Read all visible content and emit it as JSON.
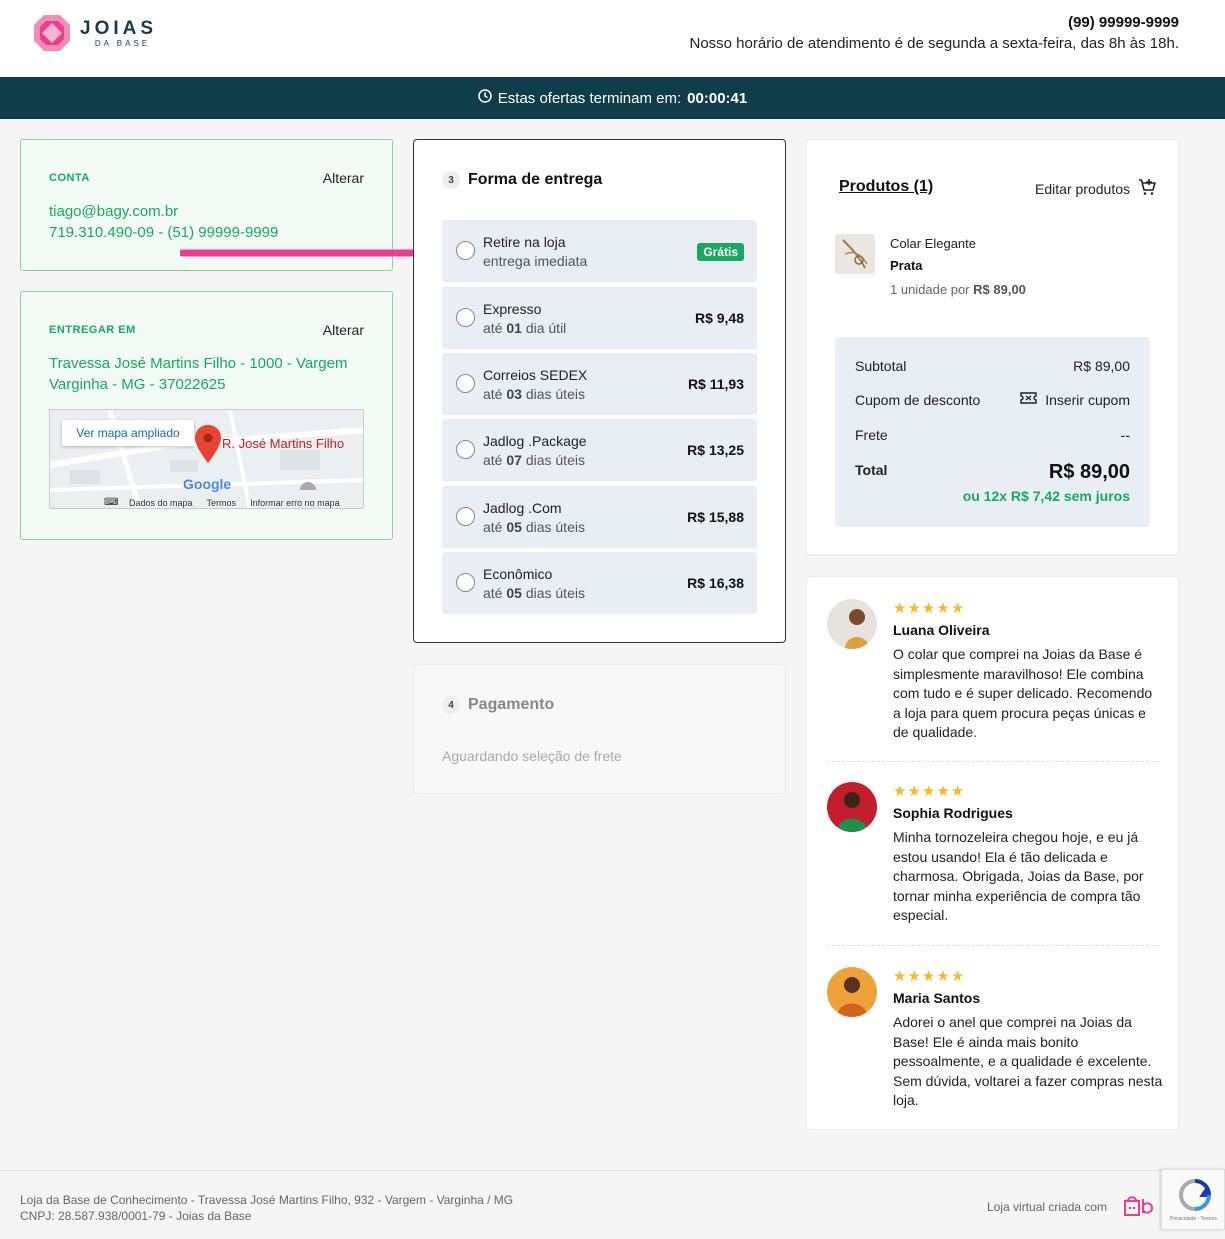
{
  "header": {
    "logo_main": "JOIAS",
    "logo_sub": "DA BASE",
    "phone": "(99) 99999-9999",
    "hours": "Nosso horário de atendimento é de segunda a sexta-feira, das 8h às 18h."
  },
  "offer": {
    "label": "Estas ofertas terminam em:",
    "timer": "00:00:41"
  },
  "account": {
    "label": "CONTA",
    "edit": "Alterar",
    "email": "tiago@bagy.com.br",
    "details": "719.310.490-09 - (51) 99999-9999"
  },
  "delivery": {
    "label": "ENTREGAR EM",
    "edit": "Alterar",
    "address_line1": "Travessa José Martins Filho - 1000 - Vargem",
    "address_line2": "Varginha - MG - 37022625",
    "map": {
      "button": "Ver mapa ampliado",
      "pin_label": "R. José Martins Filho",
      "google": "Google",
      "footer": [
        "Dados do mapa",
        "Termos",
        "Informar erro no mapa"
      ]
    }
  },
  "shipping": {
    "step": "3",
    "title": "Forma de entrega",
    "options": [
      {
        "name": "Retire na loja",
        "sub": "entrega imediata",
        "price": "Grátis"
      },
      {
        "name": "Expresso",
        "sub_pre": "até ",
        "sub_num": "01",
        "sub_post": " dia útil",
        "price": "R$ 9,48"
      },
      {
        "name": "Correios SEDEX",
        "sub_pre": "até ",
        "sub_num": "03",
        "sub_post": " dias úteis",
        "price": "R$ 11,93"
      },
      {
        "name": "Jadlog .Package",
        "sub_pre": "até ",
        "sub_num": "07",
        "sub_post": " dias úteis",
        "price": "R$ 13,25"
      },
      {
        "name": "Jadlog .Com",
        "sub_pre": "até ",
        "sub_num": "05",
        "sub_post": " dias úteis",
        "price": "R$ 15,88"
      },
      {
        "name": "Econômico",
        "sub_pre": "até ",
        "sub_num": "05",
        "sub_post": " dias úteis",
        "price": "R$ 16,38"
      }
    ]
  },
  "payment": {
    "step": "4",
    "title": "Pagamento",
    "waiting": "Aguardando seleção de frete"
  },
  "products": {
    "title": "Produtos (1)",
    "edit": "Editar produtos",
    "item": {
      "name": "Colar Elegante",
      "variant": "Prata",
      "qty_text": "1 unidade por",
      "unit_price": "R$ 89,00"
    },
    "summary": {
      "subtotal_label": "Subtotal",
      "subtotal_value": "R$ 89,00",
      "coupon_label": "Cupom de desconto",
      "coupon_action": "Inserir cupom",
      "shipping_label": "Frete",
      "shipping_value": "--",
      "total_label": "Total",
      "total_value": "R$ 89,00",
      "installments": "ou 12x R$ 7,42 sem juros"
    }
  },
  "reviews": [
    {
      "stars": "★★★★★",
      "name": "Luana Oliveira",
      "text": "O colar que comprei na Joias da Base é simplesmente maravilhoso! Ele combina com tudo e é super delicado. Recomendo a loja para quem procura peças únicas e de qualidade.",
      "avatar_color": "#c9c3bd"
    },
    {
      "stars": "★★★★★",
      "name": "Sophia Rodrigues",
      "text": "Minha tornozeleira chegou hoje, e eu já estou usando! Ela é tão delicada e charmosa. Obrigada, Joias da Base, por tornar minha experiência de compra tão especial.",
      "avatar_color": "#c41d2e"
    },
    {
      "stars": "★★★★★",
      "name": "Maria Santos",
      "text": "Adorei o anel que comprei na Joias da Base! Ele é ainda mais bonito pessoalmente, e a qualidade é excelente. Sem dúvida, voltarei a fazer compras nesta loja.",
      "avatar_color": "#f0a23a"
    }
  ],
  "footer": {
    "address": "Loja da Base de Conhecimento - Travessa José Martins Filho, 932 - Vargem - Varginha / MG",
    "cnpj": "CNPJ: 28.587.938/0001-79 - Joias da Base",
    "made_with": "Loja virtual criada com",
    "recaptcha": "Privacidade - Termos"
  },
  "colors": {
    "accent_green": "#1aa861",
    "brand_pink": "#ee3d8f",
    "offer_bar": "#0f3d4a"
  }
}
